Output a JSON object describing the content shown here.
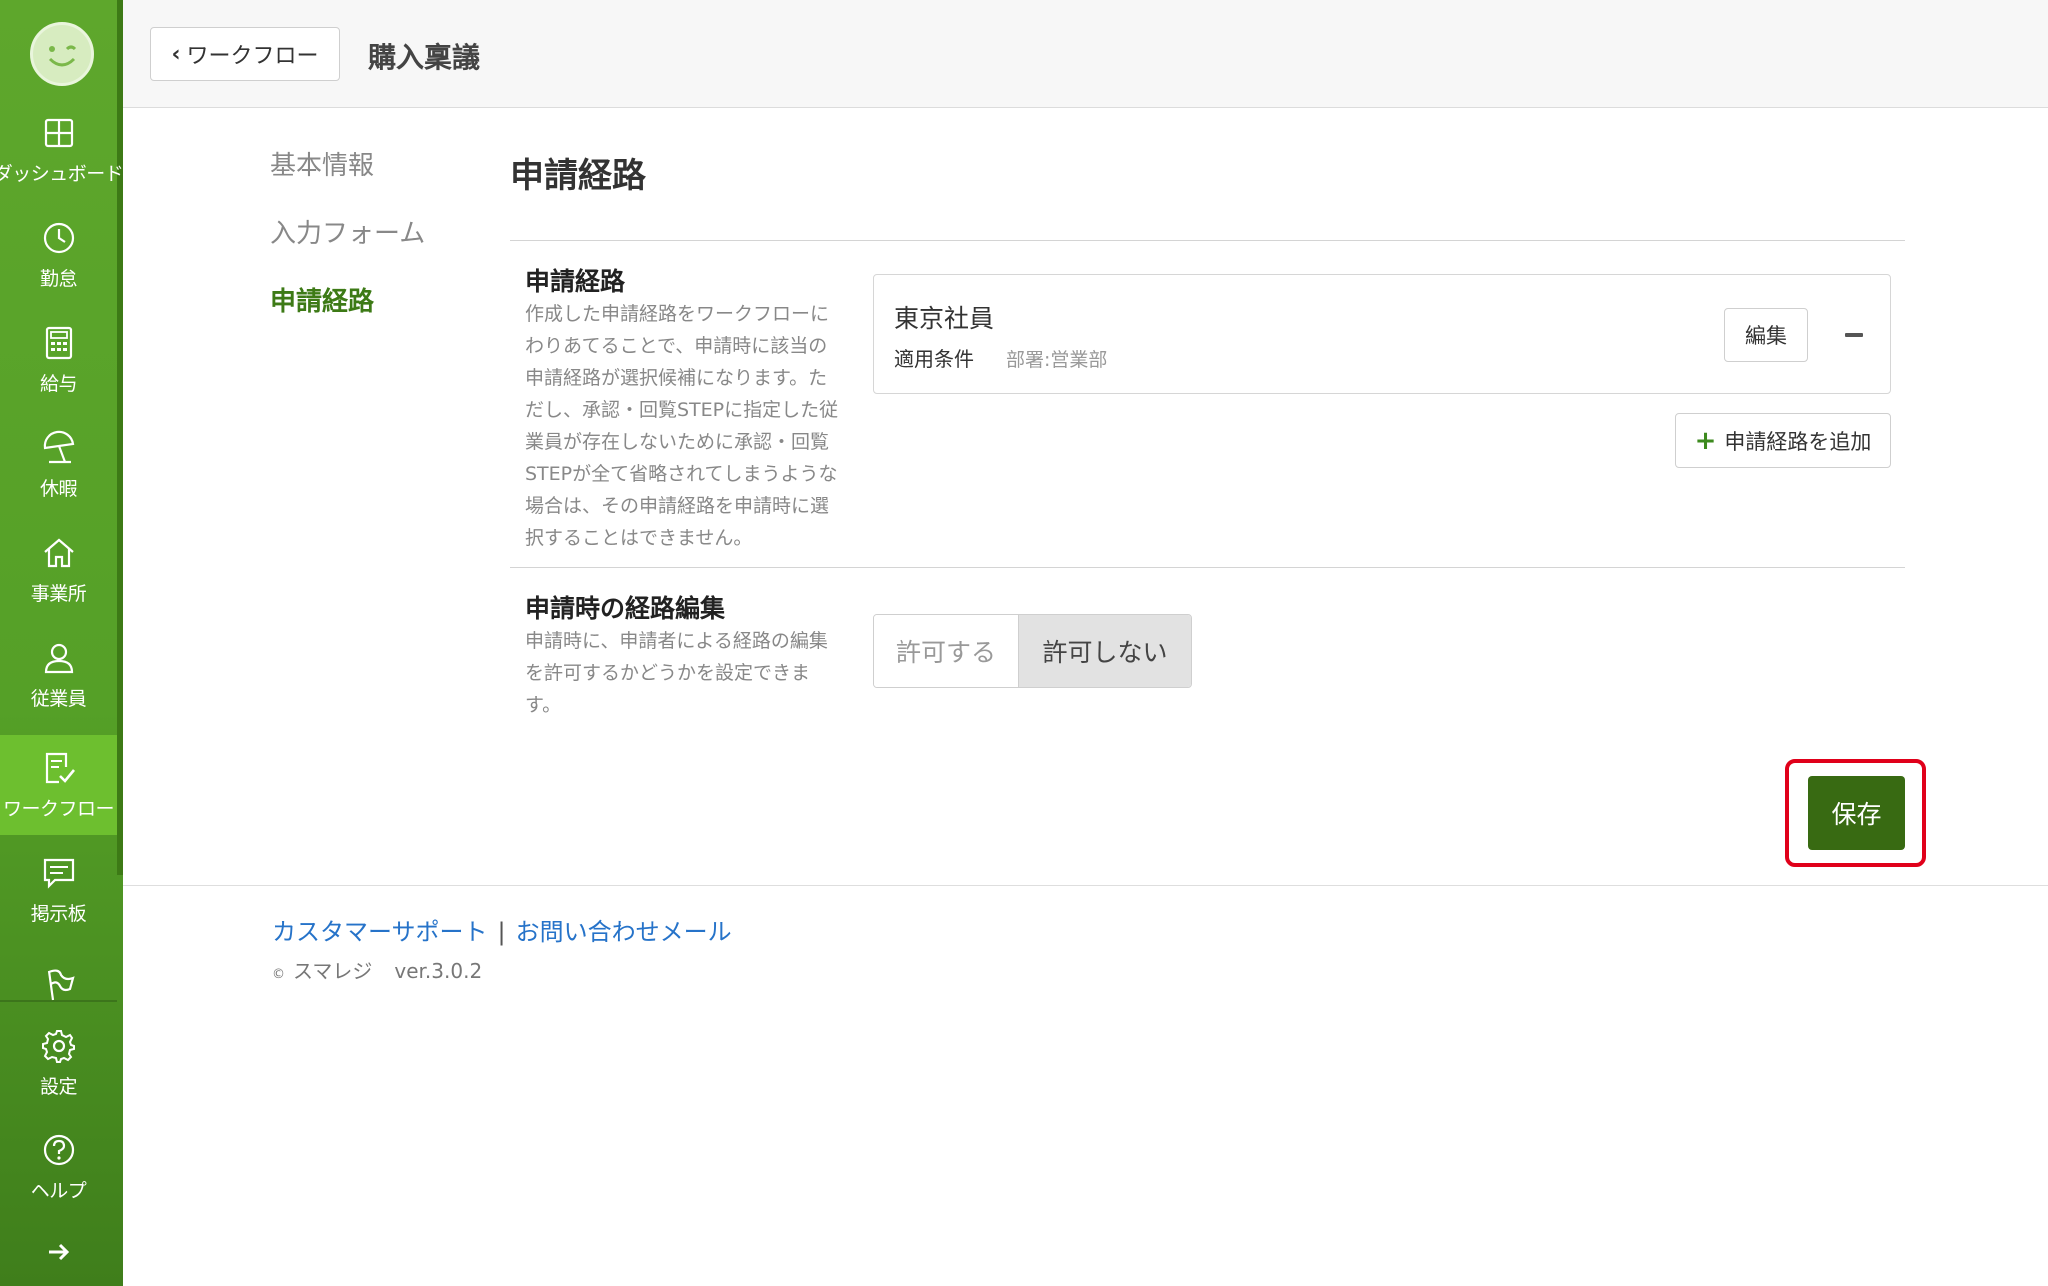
{
  "sidebar": {
    "logo": "smiley-logo",
    "items": [
      {
        "label": "ダッシュボード",
        "icon": "dashboard-icon"
      },
      {
        "label": "勤怠",
        "icon": "clock-icon"
      },
      {
        "label": "給与",
        "icon": "calculator-icon"
      },
      {
        "label": "休暇",
        "icon": "beach-umbrella-icon"
      },
      {
        "label": "事業所",
        "icon": "home-icon"
      },
      {
        "label": "従業員",
        "icon": "person-icon"
      },
      {
        "label": "ワークフロー",
        "icon": "workflow-check-icon",
        "active": true
      },
      {
        "label": "掲示板",
        "icon": "message-icon"
      },
      {
        "label": "",
        "icon": "flag-icon"
      },
      {
        "label": "設定",
        "icon": "gear-icon"
      },
      {
        "label": "ヘルプ",
        "icon": "help-circle-icon"
      }
    ],
    "collapse_icon": "arrow-right-icon"
  },
  "header": {
    "back_label": "ワークフロー",
    "title": "購入稟議"
  },
  "subnav": {
    "items": [
      "基本情報",
      "入力フォーム",
      "申請経路"
    ],
    "active": "申請経路"
  },
  "main": {
    "section_title": "申請経路",
    "route_row": {
      "title": "申請経路",
      "description": "作成した申請経路をワークフローにわりあてることで、申請時に該当の申請経路が選択候補になります。ただし、承認・回覧STEPに指定した従業員が存在しないために承認・回覧STEPが全て省略されてしまうような場合は、その申請経路を申請時に選択することはできません。",
      "route": {
        "name": "東京社員",
        "condition_label": "適用条件",
        "condition_value": "部署:営業部",
        "edit_label": "編集"
      },
      "add_label": "申請経路を追加"
    },
    "edit_row": {
      "title": "申請時の経路編集",
      "description": "申請時に、申請者による経路の編集を許可するかどうかを設定できます。",
      "options": [
        "許可する",
        "許可しない"
      ],
      "selected": "許可しない"
    },
    "save_label": "保存"
  },
  "footer": {
    "support_link": "カスタマーサポート",
    "separator": "|",
    "contact_link": "お問い合わせメール",
    "copyright_symbol": "©",
    "company": "スマレジ",
    "version": "ver.3.0.2"
  },
  "colors": {
    "sidebar_green": "#55a027",
    "active_green": "#6dbf2f",
    "save_green": "#386a12",
    "highlight_red": "#e0001a",
    "link_blue": "#2673c9"
  }
}
